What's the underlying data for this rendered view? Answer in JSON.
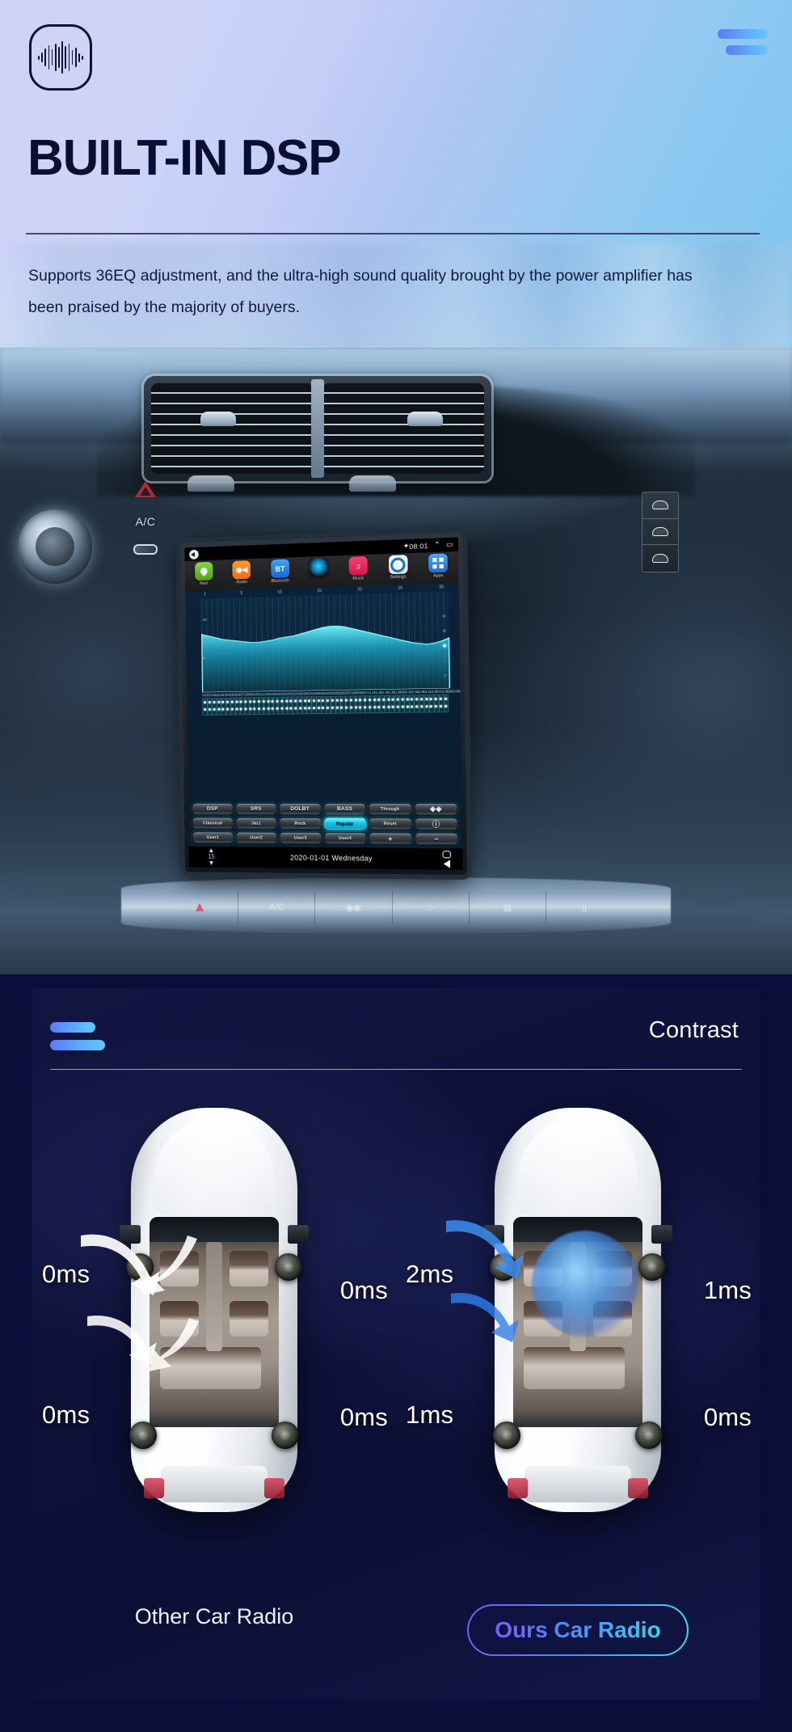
{
  "header": {
    "logo_icon": "audio-waveform-icon",
    "menu_icon": "hamburger-menu-icon",
    "title": "BUILT-IN DSP",
    "description": "Supports 36EQ adjustment, and the ultra-high sound quality brought by the power amplifier has been praised by the majority of buyers."
  },
  "radio_screen": {
    "status": {
      "back_icon": "back-icon",
      "bt_icon": "bluetooth-icon",
      "time": "08:01",
      "up_icon": "chevron-up-icon",
      "recent_icon": "recents-icon"
    },
    "apps": [
      {
        "label": "Navi",
        "icon": "navigation-icon"
      },
      {
        "label": "Radio",
        "icon": "radio-icon"
      },
      {
        "label": "Bluetooth",
        "icon": "bt-icon"
      },
      {
        "label": "",
        "icon": "dsp-icon"
      },
      {
        "label": "Music",
        "icon": "music-note-icon"
      },
      {
        "label": "Settings",
        "icon": "gear-icon"
      },
      {
        "label": "Apps",
        "icon": "apps-grid-icon"
      }
    ],
    "eq": {
      "x_ticks": [
        "1",
        "5",
        "10",
        "15",
        "20",
        "25",
        "30"
      ],
      "y_ticks": [
        "20",
        "0",
        "-20"
      ],
      "freq_labels": [
        "Hz",
        "20",
        "24",
        "28",
        "31",
        "36",
        "40",
        "45",
        "50",
        "56",
        "63",
        "71",
        "80",
        "90",
        "100",
        "112",
        "125",
        "140",
        "160",
        "180",
        "200",
        "224",
        "250",
        "280",
        "315",
        "355",
        "400",
        "450",
        "500",
        "560",
        "630",
        "710",
        "800",
        "900",
        "1k",
        "1.1k",
        "1.3k",
        "1.4k",
        "1.6k",
        "1.8k",
        "2k",
        "2.2k",
        "2.5k",
        "2.8k",
        "3.1k",
        "3.5k",
        "4k",
        "4.5k",
        "5k",
        "5.6k",
        "6.3k",
        "7.1k",
        "8k"
      ],
      "highlighted_freqs": [
        "1k",
        "4k"
      ],
      "curve_points": [
        62,
        60,
        58,
        56,
        55,
        54,
        53,
        52,
        52,
        53,
        54,
        56,
        57,
        58,
        60,
        62,
        64,
        66,
        67,
        67,
        66,
        64,
        62,
        60,
        58,
        56,
        54,
        52,
        50,
        48,
        47,
        46,
        47,
        49,
        52
      ]
    },
    "eq_buttons": [
      [
        "DSP",
        "SRS",
        "DOLBY",
        "BASS",
        "Through",
        "◈◈"
      ],
      [
        "Classical",
        "Jazz",
        "Rock",
        "Popular",
        "Reset",
        "ⓘ"
      ],
      [
        "User1",
        "User2",
        "User3",
        "User4",
        "+",
        "−"
      ]
    ],
    "active_button": "Popular",
    "navbar": {
      "volume": "15",
      "volume_up_icon": "triangle-up-icon",
      "volume_down_icon": "triangle-down-icon",
      "date": "2020-01-01  Wednesday",
      "home_icon": "home-icon",
      "back_icon": "back-triangle-icon"
    }
  },
  "dashboard": {
    "hazard_icon": "hazard-triangle-icon",
    "ac_label": "A/C",
    "rear_defrost_icon": "rear-defrost-icon",
    "side_buttons": [
      "front-defrost-icon",
      "rear-defrost-icon",
      "recirculate-icon"
    ],
    "console_icons": [
      "hazard-icon",
      "ac-icon",
      "fan-icon",
      "front-defrost-icon",
      "rear-defrost-icon",
      "seat-heater-icon"
    ]
  },
  "contrast_panel": {
    "menu_icon": "hamburger-menu-icon",
    "title": "Contrast",
    "left_car": {
      "caption": "Other Car Radio",
      "delays": {
        "front_left": "0ms",
        "front_right": "0ms",
        "rear_left": "0ms",
        "rear_right": "0ms"
      }
    },
    "right_car": {
      "caption": "Ours Car Radio",
      "delays": {
        "front_left": "2ms",
        "front_right": "1ms",
        "rear_left": "1ms",
        "rear_right": "0ms"
      }
    }
  },
  "colors": {
    "accent_blue": "#5a7bf5",
    "accent_cyan": "#3fd8f2",
    "accent_purple": "#7a5cf7",
    "panel_bg": "#0e1239",
    "title_dark": "#090e33",
    "eq_active": "#17c4e4"
  }
}
